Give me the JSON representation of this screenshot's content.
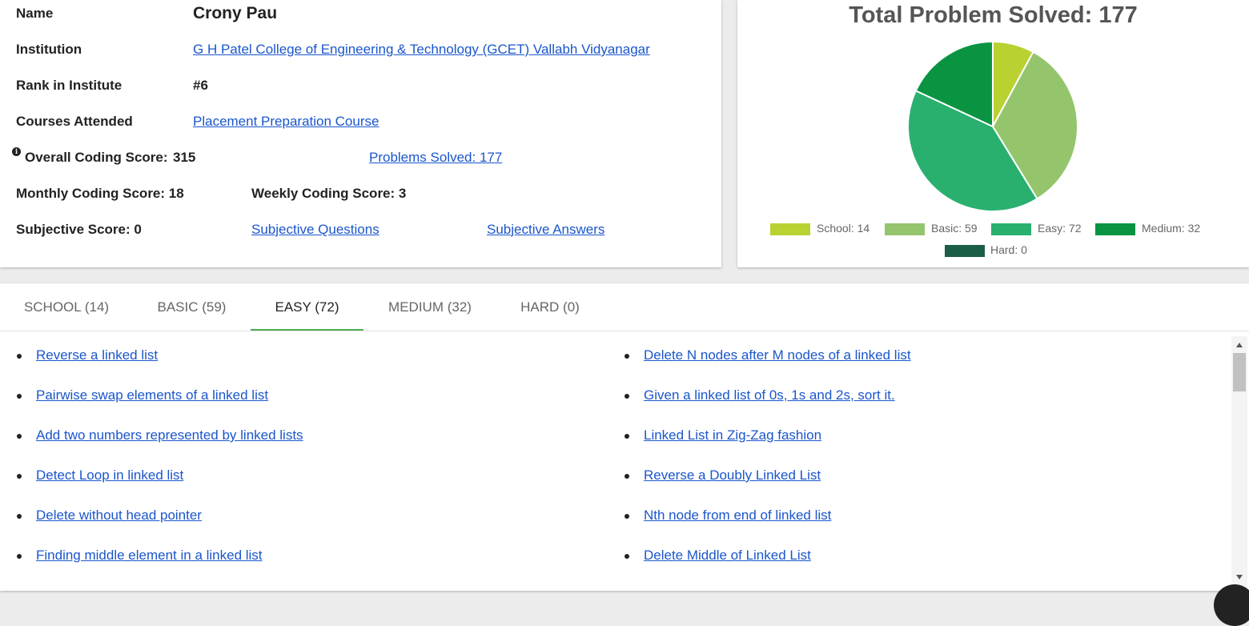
{
  "profile": {
    "name_label": "Name",
    "name_value": "Crony Pau",
    "institution_label": "Institution",
    "institution_value": "G H Patel College of Engineering & Technology (GCET) Vallabh Vidyanagar",
    "rank_label": "Rank in Institute",
    "rank_value": "#6",
    "courses_label": "Courses Attended",
    "courses_value": "Placement Preparation Course",
    "overall_label": "Overall Coding Score:",
    "overall_value": "315",
    "problems_solved_link": "Problems Solved: 177",
    "monthly_label": "Monthly Coding Score: 18",
    "weekly_label": "Weekly Coding Score: 3",
    "subjective_label": "Subjective Score: 0",
    "subjective_questions_link": "Subjective Questions",
    "subjective_answers_link": "Subjective Answers",
    "info_icon": "info-icon"
  },
  "chart_data": {
    "type": "pie",
    "title": "Total Problem Solved: 177",
    "categories": [
      "School",
      "Basic",
      "Easy",
      "Medium",
      "Hard"
    ],
    "values": [
      14,
      59,
      72,
      32,
      0
    ],
    "colors": [
      "#b9d232",
      "#94c56c",
      "#29b06f",
      "#0a9442",
      "#1a5e48"
    ],
    "legend_labels": [
      "School: 14",
      "Basic: 59",
      "Easy: 72",
      "Medium: 32",
      "Hard: 0"
    ],
    "legend_position": "bottom"
  },
  "tabs": [
    {
      "label": "SCHOOL (14)",
      "active": false
    },
    {
      "label": "BASIC (59)",
      "active": false
    },
    {
      "label": "EASY (72)",
      "active": true
    },
    {
      "label": "MEDIUM (32)",
      "active": false
    },
    {
      "label": "HARD (0)",
      "active": false
    }
  ],
  "problems": {
    "left": [
      "Reverse a linked list",
      "Pairwise swap elements of a linked list",
      "Add two numbers represented by linked lists",
      "Detect Loop in linked list",
      "Delete without head pointer",
      "Finding middle element in a linked list"
    ],
    "right": [
      "Delete N nodes after M nodes of a linked list",
      "Given a linked list of 0s, 1s and 2s, sort it.",
      "Linked List in Zig-Zag fashion",
      "Reverse a Doubly Linked List",
      "Nth node from end of linked list",
      "Delete Middle of Linked List"
    ]
  },
  "colors": {
    "link": "#1a56cc",
    "tab_active_underline": "#4caf50"
  }
}
